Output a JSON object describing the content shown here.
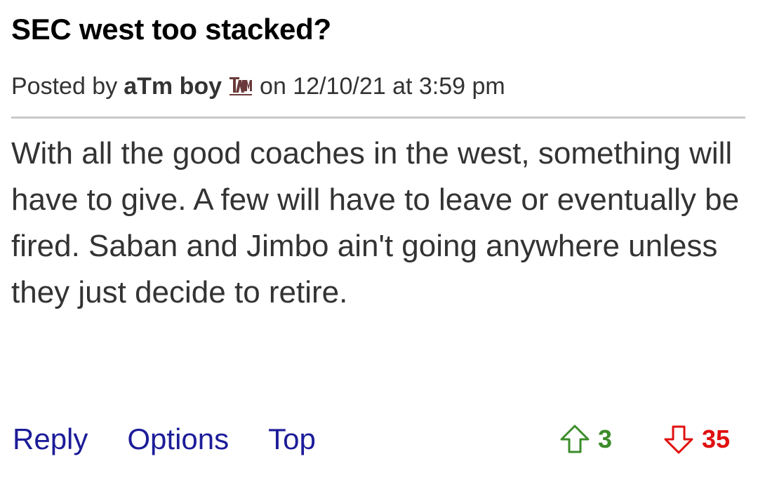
{
  "post": {
    "title": "SEC west too stacked?",
    "meta": {
      "prefix": "Posted by",
      "author": "aTm boy",
      "team_logo_icon": "texas-am-logo-icon",
      "suffix": "on 12/10/21 at 3:59 pm"
    },
    "body": "With all the good coaches in the west, something will have to give. A few will have to leave or eventually be fired. Saban and Jimbo ain't going anywhere unless they just decide to retire."
  },
  "actions": {
    "reply": "Reply",
    "options": "Options",
    "top": "Top"
  },
  "votes": {
    "up_count": "3",
    "up_icon": "thumbs-up-arrow-icon",
    "up_color": "#3c8c2a",
    "down_count": "35",
    "down_icon": "thumbs-down-arrow-icon",
    "down_color": "#e01010"
  },
  "colors": {
    "link": "#1c1c99",
    "divider": "#c8c8c8",
    "body_text": "#333333"
  }
}
